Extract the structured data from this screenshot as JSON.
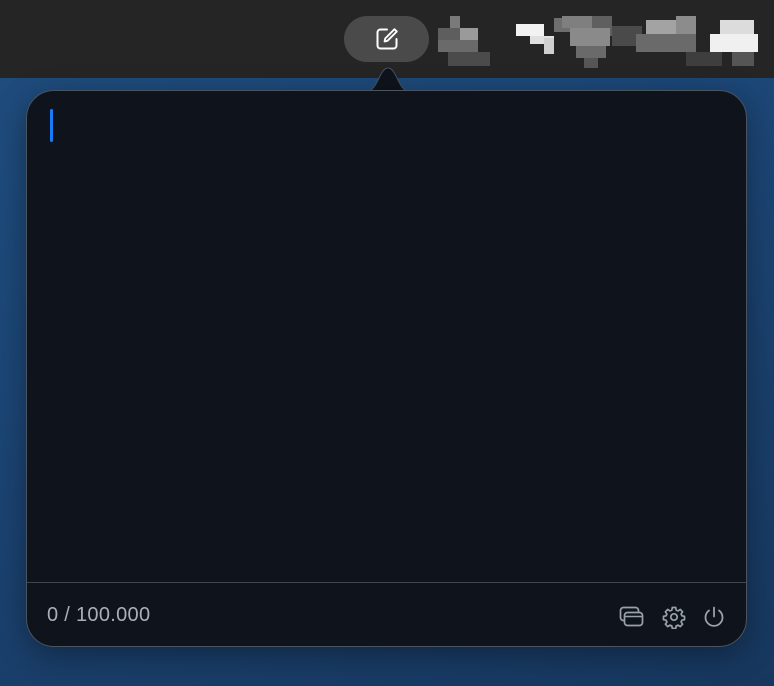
{
  "editor": {
    "text": "",
    "char_count": "0 / 100.000"
  },
  "menubar": {
    "icons": [
      "edit-note-icon",
      "menubar-icon-1",
      "menubar-icon-2",
      "menubar-icon-3",
      "menubar-icon-4"
    ]
  },
  "footer": {
    "icons": [
      "windows-icon",
      "gear-icon",
      "power-icon"
    ]
  },
  "colors": {
    "accent": "#1a7cf5",
    "panel": "#0f141c",
    "menubar": "#252526",
    "desktop": "#1f4d7e"
  }
}
